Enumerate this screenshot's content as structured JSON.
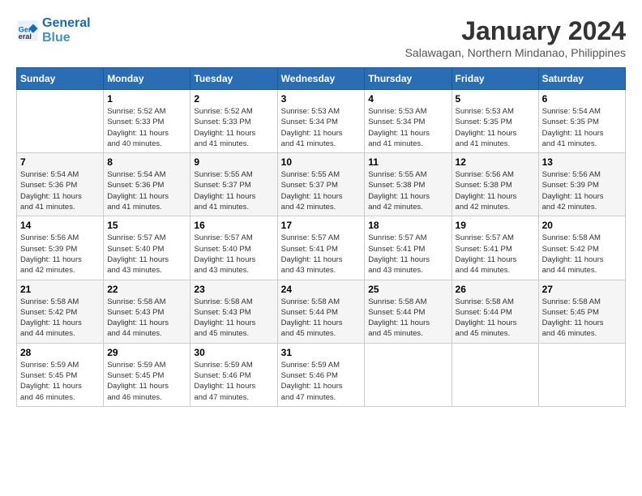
{
  "header": {
    "logo_line1": "General",
    "logo_line2": "Blue",
    "month": "January 2024",
    "location": "Salawagan, Northern Mindanao, Philippines"
  },
  "days_of_week": [
    "Sunday",
    "Monday",
    "Tuesday",
    "Wednesday",
    "Thursday",
    "Friday",
    "Saturday"
  ],
  "weeks": [
    [
      {
        "day": "",
        "info": ""
      },
      {
        "day": "1",
        "info": "Sunrise: 5:52 AM\nSunset: 5:33 PM\nDaylight: 11 hours\nand 40 minutes."
      },
      {
        "day": "2",
        "info": "Sunrise: 5:52 AM\nSunset: 5:33 PM\nDaylight: 11 hours\nand 41 minutes."
      },
      {
        "day": "3",
        "info": "Sunrise: 5:53 AM\nSunset: 5:34 PM\nDaylight: 11 hours\nand 41 minutes."
      },
      {
        "day": "4",
        "info": "Sunrise: 5:53 AM\nSunset: 5:34 PM\nDaylight: 11 hours\nand 41 minutes."
      },
      {
        "day": "5",
        "info": "Sunrise: 5:53 AM\nSunset: 5:35 PM\nDaylight: 11 hours\nand 41 minutes."
      },
      {
        "day": "6",
        "info": "Sunrise: 5:54 AM\nSunset: 5:35 PM\nDaylight: 11 hours\nand 41 minutes."
      }
    ],
    [
      {
        "day": "7",
        "info": "Sunrise: 5:54 AM\nSunset: 5:36 PM\nDaylight: 11 hours\nand 41 minutes."
      },
      {
        "day": "8",
        "info": "Sunrise: 5:54 AM\nSunset: 5:36 PM\nDaylight: 11 hours\nand 41 minutes."
      },
      {
        "day": "9",
        "info": "Sunrise: 5:55 AM\nSunset: 5:37 PM\nDaylight: 11 hours\nand 41 minutes."
      },
      {
        "day": "10",
        "info": "Sunrise: 5:55 AM\nSunset: 5:37 PM\nDaylight: 11 hours\nand 42 minutes."
      },
      {
        "day": "11",
        "info": "Sunrise: 5:55 AM\nSunset: 5:38 PM\nDaylight: 11 hours\nand 42 minutes."
      },
      {
        "day": "12",
        "info": "Sunrise: 5:56 AM\nSunset: 5:38 PM\nDaylight: 11 hours\nand 42 minutes."
      },
      {
        "day": "13",
        "info": "Sunrise: 5:56 AM\nSunset: 5:39 PM\nDaylight: 11 hours\nand 42 minutes."
      }
    ],
    [
      {
        "day": "14",
        "info": "Sunrise: 5:56 AM\nSunset: 5:39 PM\nDaylight: 11 hours\nand 42 minutes."
      },
      {
        "day": "15",
        "info": "Sunrise: 5:57 AM\nSunset: 5:40 PM\nDaylight: 11 hours\nand 43 minutes."
      },
      {
        "day": "16",
        "info": "Sunrise: 5:57 AM\nSunset: 5:40 PM\nDaylight: 11 hours\nand 43 minutes."
      },
      {
        "day": "17",
        "info": "Sunrise: 5:57 AM\nSunset: 5:41 PM\nDaylight: 11 hours\nand 43 minutes."
      },
      {
        "day": "18",
        "info": "Sunrise: 5:57 AM\nSunset: 5:41 PM\nDaylight: 11 hours\nand 43 minutes."
      },
      {
        "day": "19",
        "info": "Sunrise: 5:57 AM\nSunset: 5:41 PM\nDaylight: 11 hours\nand 44 minutes."
      },
      {
        "day": "20",
        "info": "Sunrise: 5:58 AM\nSunset: 5:42 PM\nDaylight: 11 hours\nand 44 minutes."
      }
    ],
    [
      {
        "day": "21",
        "info": "Sunrise: 5:58 AM\nSunset: 5:42 PM\nDaylight: 11 hours\nand 44 minutes."
      },
      {
        "day": "22",
        "info": "Sunrise: 5:58 AM\nSunset: 5:43 PM\nDaylight: 11 hours\nand 44 minutes."
      },
      {
        "day": "23",
        "info": "Sunrise: 5:58 AM\nSunset: 5:43 PM\nDaylight: 11 hours\nand 45 minutes."
      },
      {
        "day": "24",
        "info": "Sunrise: 5:58 AM\nSunset: 5:44 PM\nDaylight: 11 hours\nand 45 minutes."
      },
      {
        "day": "25",
        "info": "Sunrise: 5:58 AM\nSunset: 5:44 PM\nDaylight: 11 hours\nand 45 minutes."
      },
      {
        "day": "26",
        "info": "Sunrise: 5:58 AM\nSunset: 5:44 PM\nDaylight: 11 hours\nand 45 minutes."
      },
      {
        "day": "27",
        "info": "Sunrise: 5:58 AM\nSunset: 5:45 PM\nDaylight: 11 hours\nand 46 minutes."
      }
    ],
    [
      {
        "day": "28",
        "info": "Sunrise: 5:59 AM\nSunset: 5:45 PM\nDaylight: 11 hours\nand 46 minutes."
      },
      {
        "day": "29",
        "info": "Sunrise: 5:59 AM\nSunset: 5:45 PM\nDaylight: 11 hours\nand 46 minutes."
      },
      {
        "day": "30",
        "info": "Sunrise: 5:59 AM\nSunset: 5:46 PM\nDaylight: 11 hours\nand 47 minutes."
      },
      {
        "day": "31",
        "info": "Sunrise: 5:59 AM\nSunset: 5:46 PM\nDaylight: 11 hours\nand 47 minutes."
      },
      {
        "day": "",
        "info": ""
      },
      {
        "day": "",
        "info": ""
      },
      {
        "day": "",
        "info": ""
      }
    ]
  ]
}
